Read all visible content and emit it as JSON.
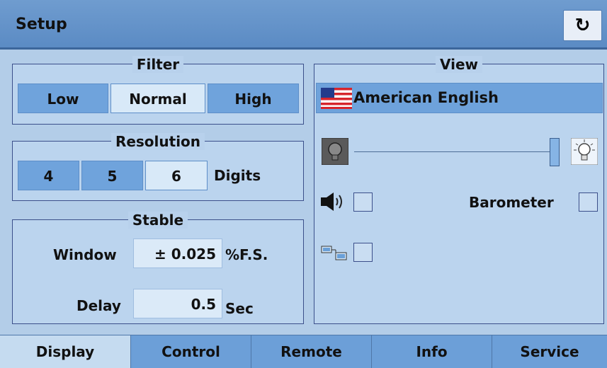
{
  "header": {
    "title": "Setup",
    "refresh_icon": "refresh-icon"
  },
  "filter": {
    "title": "Filter",
    "options": [
      "Low",
      "Normal",
      "High"
    ],
    "selected": "Normal"
  },
  "resolution": {
    "title": "Resolution",
    "options": [
      "4",
      "5",
      "6"
    ],
    "selected": "6",
    "unit": "Digits"
  },
  "stable": {
    "title": "Stable",
    "window_label": "Window",
    "window_value": "± 0.025",
    "window_unit": "%F.S.",
    "delay_label": "Delay",
    "delay_value": "0.5",
    "delay_unit": "Sec"
  },
  "view": {
    "title": "View",
    "language": "American English",
    "flag_icon": "us-flag-icon",
    "brightness": 0.95,
    "barometer_label": "Barometer",
    "sound_checked": false,
    "barometer_checked": false,
    "network_checked": false
  },
  "tabs": [
    "Display",
    "Control",
    "Remote",
    "Info",
    "Service"
  ],
  "active_tab": "Display"
}
